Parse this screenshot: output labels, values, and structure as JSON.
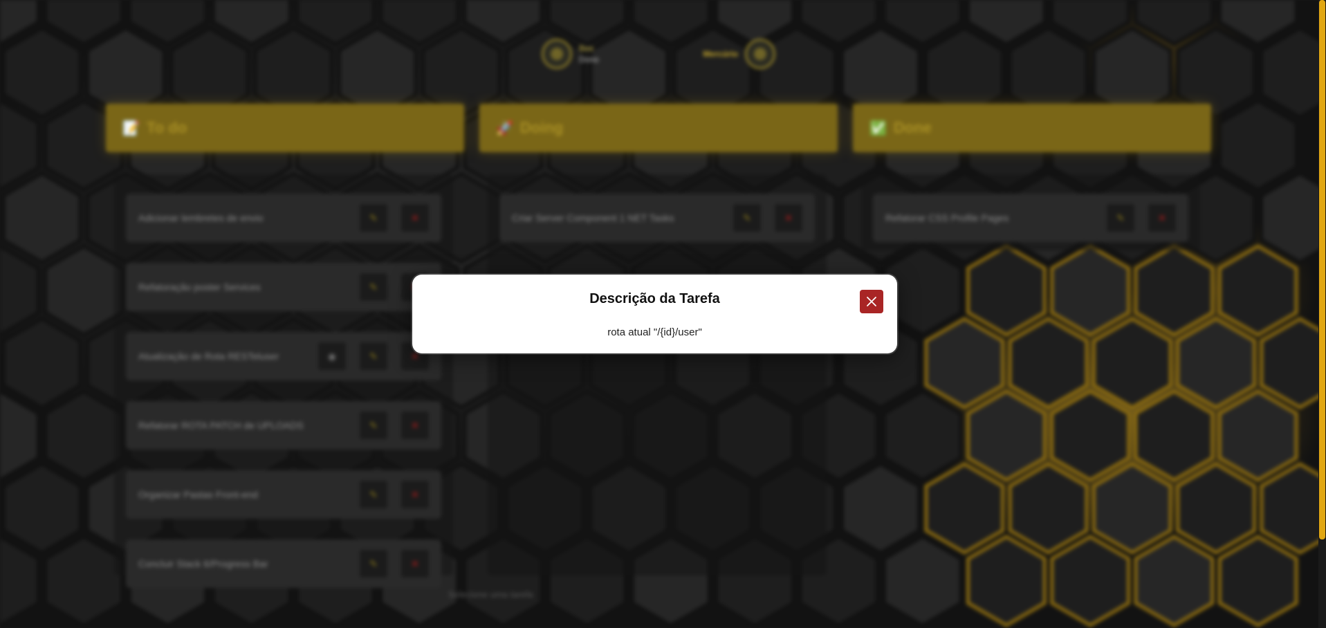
{
  "user": {
    "name": "Bee",
    "role": "Dono",
    "progress_label": "Mercúrio"
  },
  "columns": [
    {
      "title": "To do",
      "icon": "📝",
      "tasks": [
        {
          "title": "Adicionar lembretes de envio",
          "has_view": false
        },
        {
          "title": "Refatoração poster Services",
          "has_view": false
        },
        {
          "title": "Atualização de Rota RESTeluser",
          "has_view": true
        },
        {
          "title": "Refatorar ROTA PATCH de UPLOADS",
          "has_view": false
        },
        {
          "title": "Organizar Pastas Front-end",
          "has_view": false
        },
        {
          "title": "Concluir Stack 6/Progress Bar",
          "has_view": false
        }
      ]
    },
    {
      "title": "Doing",
      "icon": "🚀",
      "tasks": [
        {
          "title": "Criar Server Component 1 NET Tasks",
          "has_view": false
        }
      ]
    },
    {
      "title": "Done",
      "icon": "✅",
      "tasks": [
        {
          "title": "Refatorar CSS Profile Pages",
          "has_view": false
        }
      ]
    }
  ],
  "footer": {
    "hint": "Selecione uma tarefa"
  },
  "modal": {
    "title": "Descrição da Tarefa",
    "description": "rota atual \"/{id}/user\"",
    "close_icon": "close-icon"
  },
  "colors": {
    "accent": "#e1a712",
    "close_button": "#a92525",
    "modal_bg": "#ffffff"
  }
}
